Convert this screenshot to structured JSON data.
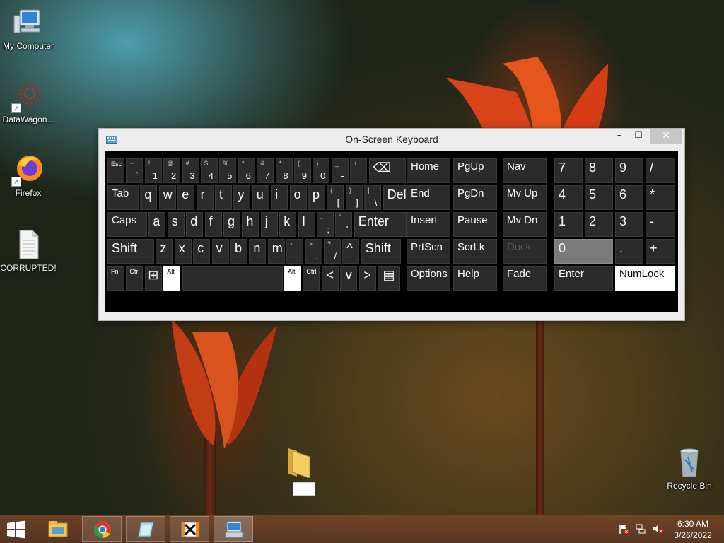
{
  "desktop": {
    "icons": [
      {
        "label": "My Computer",
        "icon": "computer-icon"
      },
      {
        "label": "DataWagon...",
        "icon": "datawagon-icon"
      },
      {
        "label": "Firefox",
        "icon": "firefox-icon"
      },
      {
        "label": "CORRUPTED!",
        "icon": "text-file-icon"
      },
      {
        "label": "Recycle Bin",
        "icon": "recycle-bin-icon"
      }
    ],
    "folder": {
      "icon": "folder-icon",
      "label": ""
    }
  },
  "osk": {
    "title": "On-Screen Keyboard",
    "close_glyph": "✕",
    "minimize_glyph": "–",
    "maximize_glyph": "☐",
    "rows": {
      "r1": [
        {
          "main": "Esc"
        },
        {
          "sup": "~",
          "sub": "`"
        },
        {
          "sup": "!",
          "sub": "1"
        },
        {
          "sup": "@",
          "sub": "2"
        },
        {
          "sup": "#",
          "sub": "3"
        },
        {
          "sup": "$",
          "sub": "4"
        },
        {
          "sup": "%",
          "sub": "5"
        },
        {
          "sup": "^",
          "sub": "6"
        },
        {
          "sup": "&",
          "sub": "7"
        },
        {
          "sup": "*",
          "sub": "8"
        },
        {
          "sup": "(",
          "sub": "9"
        },
        {
          "sup": ")",
          "sub": "0"
        },
        {
          "sup": "_",
          "sub": "-"
        },
        {
          "sup": "+",
          "sub": "="
        },
        {
          "main": "⌫"
        }
      ],
      "r2": [
        {
          "main": "Tab"
        },
        {
          "main": "q"
        },
        {
          "main": "w"
        },
        {
          "main": "e"
        },
        {
          "main": "r"
        },
        {
          "main": "t"
        },
        {
          "main": "y"
        },
        {
          "main": "u"
        },
        {
          "main": "i"
        },
        {
          "main": "o"
        },
        {
          "main": "p"
        },
        {
          "sup": "{",
          "sub": "["
        },
        {
          "sup": "}",
          "sub": "]"
        },
        {
          "sup": "|",
          "sub": "\\"
        },
        {
          "main": "Del"
        }
      ],
      "r3": [
        {
          "main": "Caps"
        },
        {
          "main": "a"
        },
        {
          "main": "s"
        },
        {
          "main": "d"
        },
        {
          "main": "f"
        },
        {
          "main": "g"
        },
        {
          "main": "h"
        },
        {
          "main": "j"
        },
        {
          "main": "k"
        },
        {
          "main": "l"
        },
        {
          "sup": ":",
          "sub": ";"
        },
        {
          "sup": "\"",
          "sub": "'"
        },
        {
          "main": "Enter"
        }
      ],
      "r4": [
        {
          "main": "Shift"
        },
        {
          "main": "z"
        },
        {
          "main": "x"
        },
        {
          "main": "c"
        },
        {
          "main": "v"
        },
        {
          "main": "b"
        },
        {
          "main": "n"
        },
        {
          "main": "m"
        },
        {
          "sup": "<",
          "sub": ","
        },
        {
          "sup": ">",
          "sub": "."
        },
        {
          "sup": "?",
          "sub": "/"
        },
        {
          "main": "^"
        },
        {
          "main": "Shift"
        }
      ],
      "r5": [
        {
          "main": "Fn"
        },
        {
          "main": "Ctrl"
        },
        {
          "main": "⊞"
        },
        {
          "main": "Alt"
        },
        {
          "main": ""
        },
        {
          "main": "Alt"
        },
        {
          "main": "Ctrl"
        },
        {
          "main": "<"
        },
        {
          "main": "v"
        },
        {
          "main": ">"
        },
        {
          "main": "▤"
        }
      ]
    },
    "nav": [
      [
        "Home",
        "PgUp",
        "Nav"
      ],
      [
        "End",
        "PgDn",
        "Mv Up"
      ],
      [
        "Insert",
        "Pause",
        "Mv Dn"
      ],
      [
        "PrtScn",
        "ScrLk",
        "Dock"
      ],
      [
        "Options",
        "Help",
        "Fade"
      ]
    ],
    "numpad": [
      [
        "7",
        "8",
        "9",
        "/"
      ],
      [
        "4",
        "5",
        "6",
        "*"
      ],
      [
        "1",
        "2",
        "3",
        "-"
      ],
      [
        "0",
        ".",
        "+"
      ],
      [
        "Enter",
        "NumLock"
      ]
    ]
  },
  "taskbar": {
    "apps": [
      "file-explorer-icon",
      "chrome-icon",
      "notepad-icon",
      "xampp-icon",
      "onscreen-keyboard-icon"
    ],
    "tray": [
      "action-center-flag-icon",
      "network-icon",
      "speaker-muted-icon"
    ],
    "clock": {
      "time": "6:30 AM",
      "date": "3/26/2022"
    }
  },
  "colors": {
    "accent": "#ffffff",
    "key_bg": "#2b2b2b",
    "window_bg": "#ededed"
  }
}
